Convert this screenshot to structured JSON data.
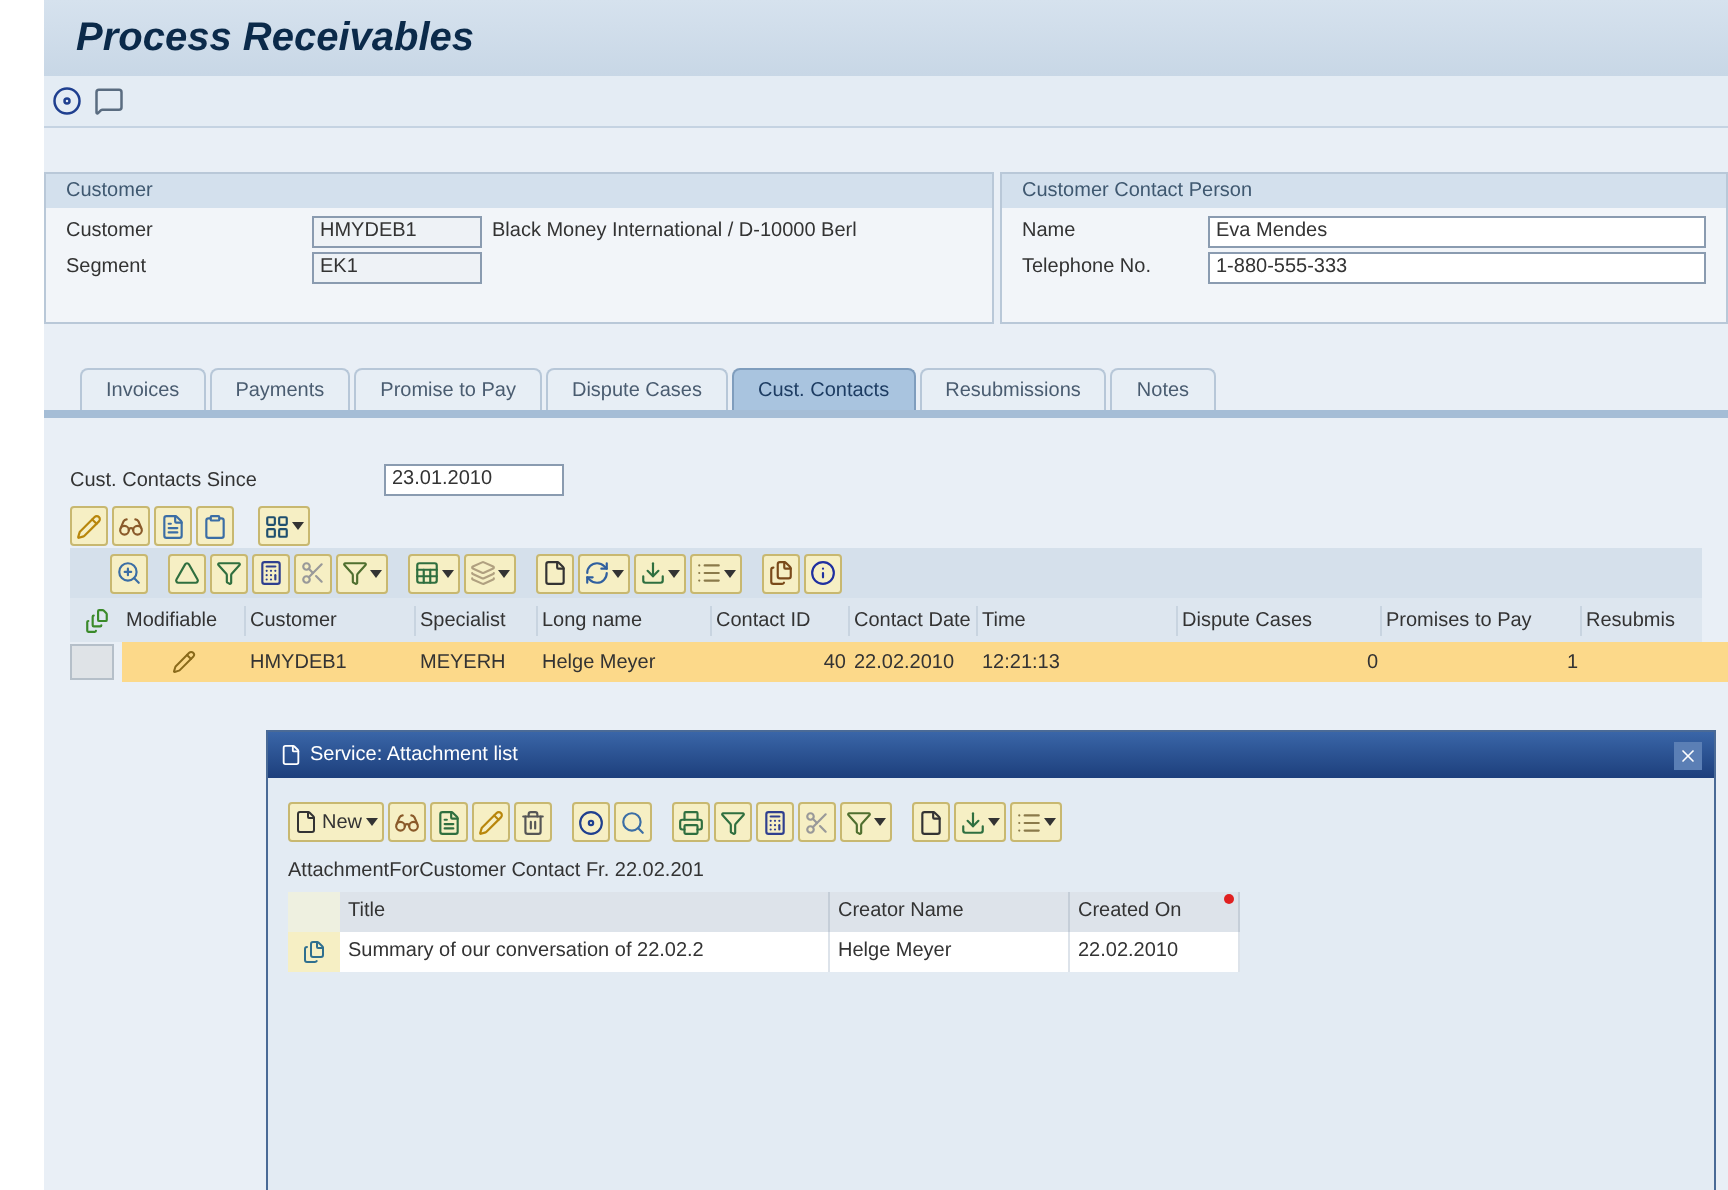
{
  "window": {
    "title": "Process Receivables"
  },
  "customer_group": {
    "title": "Customer",
    "fields": [
      {
        "label": "Customer",
        "value": "HMYDEB1",
        "description": "Black Money International / D-10000 Berl"
      },
      {
        "label": "Segment",
        "value": "EK1"
      }
    ]
  },
  "contact_group": {
    "title": "Customer Contact Person",
    "fields": [
      {
        "label": "Name",
        "value": "Eva Mendes"
      },
      {
        "label": "Telephone No.",
        "value": "1-880-555-333"
      }
    ]
  },
  "tabs": [
    {
      "label": "Invoices",
      "selected": false
    },
    {
      "label": "Payments",
      "selected": false
    },
    {
      "label": "Promise to Pay",
      "selected": false
    },
    {
      "label": "Dispute Cases",
      "selected": false
    },
    {
      "label": "Cust. Contacts",
      "selected": true
    },
    {
      "label": "Resubmissions",
      "selected": false
    },
    {
      "label": "Notes",
      "selected": false
    }
  ],
  "contacts_since": {
    "label": "Cust. Contacts Since",
    "value": "23.01.2010"
  },
  "table": {
    "columns": [
      "Modifiable",
      "Customer",
      "Specialist",
      "Long name",
      "Contact ID",
      "Contact Date",
      "Time",
      "Dispute Cases",
      "Promises to Pay",
      "Resubmis"
    ],
    "rows": [
      {
        "selected": true,
        "modifiable": true,
        "cells": [
          "",
          "HMYDEB1",
          "MEYERH",
          "Helge Meyer",
          "40",
          "22.02.2010",
          "12:21:13",
          "0",
          "1",
          ""
        ]
      }
    ]
  },
  "dialog": {
    "title": "Service: Attachment list",
    "new_button": "New",
    "caption": "AttachmentForCustomer Contact Fr. 22.02.201",
    "columns": [
      {
        "label": "Title",
        "sorted": false
      },
      {
        "label": "Creator Name",
        "sorted": false
      },
      {
        "label": "Created On",
        "sorted": true
      }
    ],
    "rows": [
      {
        "cells": [
          "Summary of our conversation of 22.02.2",
          "Helge Meyer",
          "22.02.2010"
        ]
      }
    ]
  }
}
